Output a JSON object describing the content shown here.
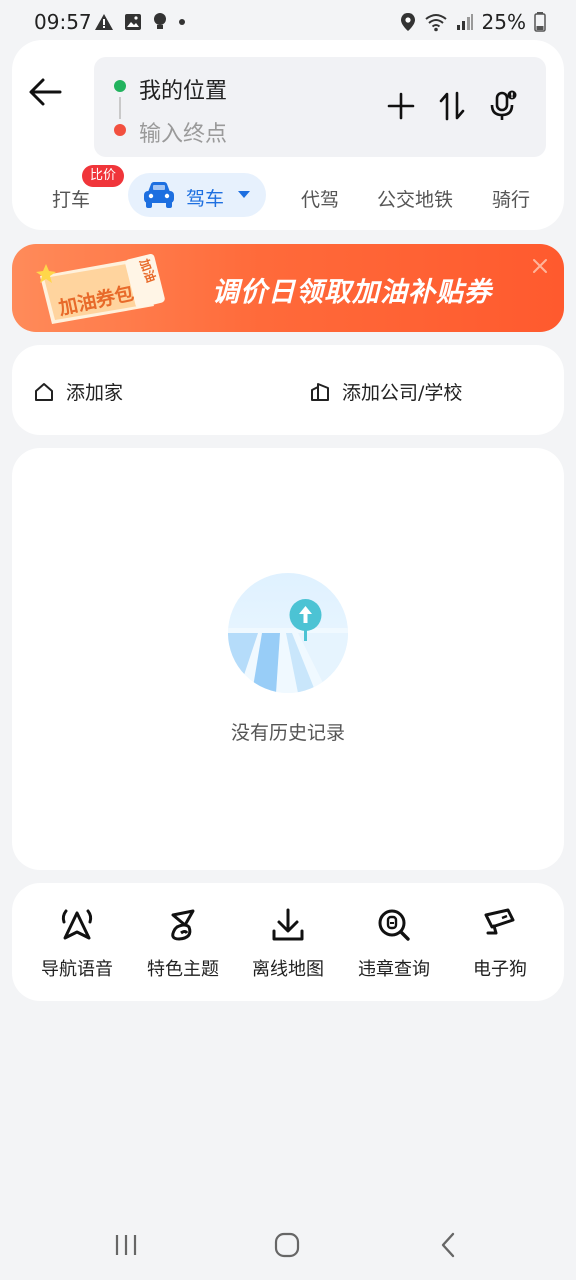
{
  "status_bar": {
    "time": "09:57",
    "battery": "25%"
  },
  "route": {
    "from_label": "我的位置",
    "to_placeholder": "输入终点"
  },
  "tabs": [
    {
      "label": "打车",
      "badge": "比价"
    },
    {
      "label": "驾车",
      "active": true
    },
    {
      "label": "代驾"
    },
    {
      "label": "公交地铁"
    },
    {
      "label": "骑行"
    }
  ],
  "banner": {
    "text": "调价日领取加油补贴券",
    "ticket_text": "加油券包",
    "ticket_corner": "加油"
  },
  "shortcuts": {
    "home": "添加家",
    "work": "添加公司/学校"
  },
  "history": {
    "empty_text": "没有历史记录"
  },
  "tools": [
    {
      "label": "导航语音",
      "icon": "nav-voice-icon"
    },
    {
      "label": "特色主题",
      "icon": "theme-icon"
    },
    {
      "label": "离线地图",
      "icon": "download-icon"
    },
    {
      "label": "违章查询",
      "icon": "violation-search-icon"
    },
    {
      "label": "电子狗",
      "icon": "camera-icon"
    }
  ],
  "colors": {
    "accent_blue": "#1d6fe0",
    "origin_green": "#22b35e",
    "dest_red": "#f2503f",
    "badge_red": "#f0353a",
    "banner_orange": "#ff6a3a"
  }
}
